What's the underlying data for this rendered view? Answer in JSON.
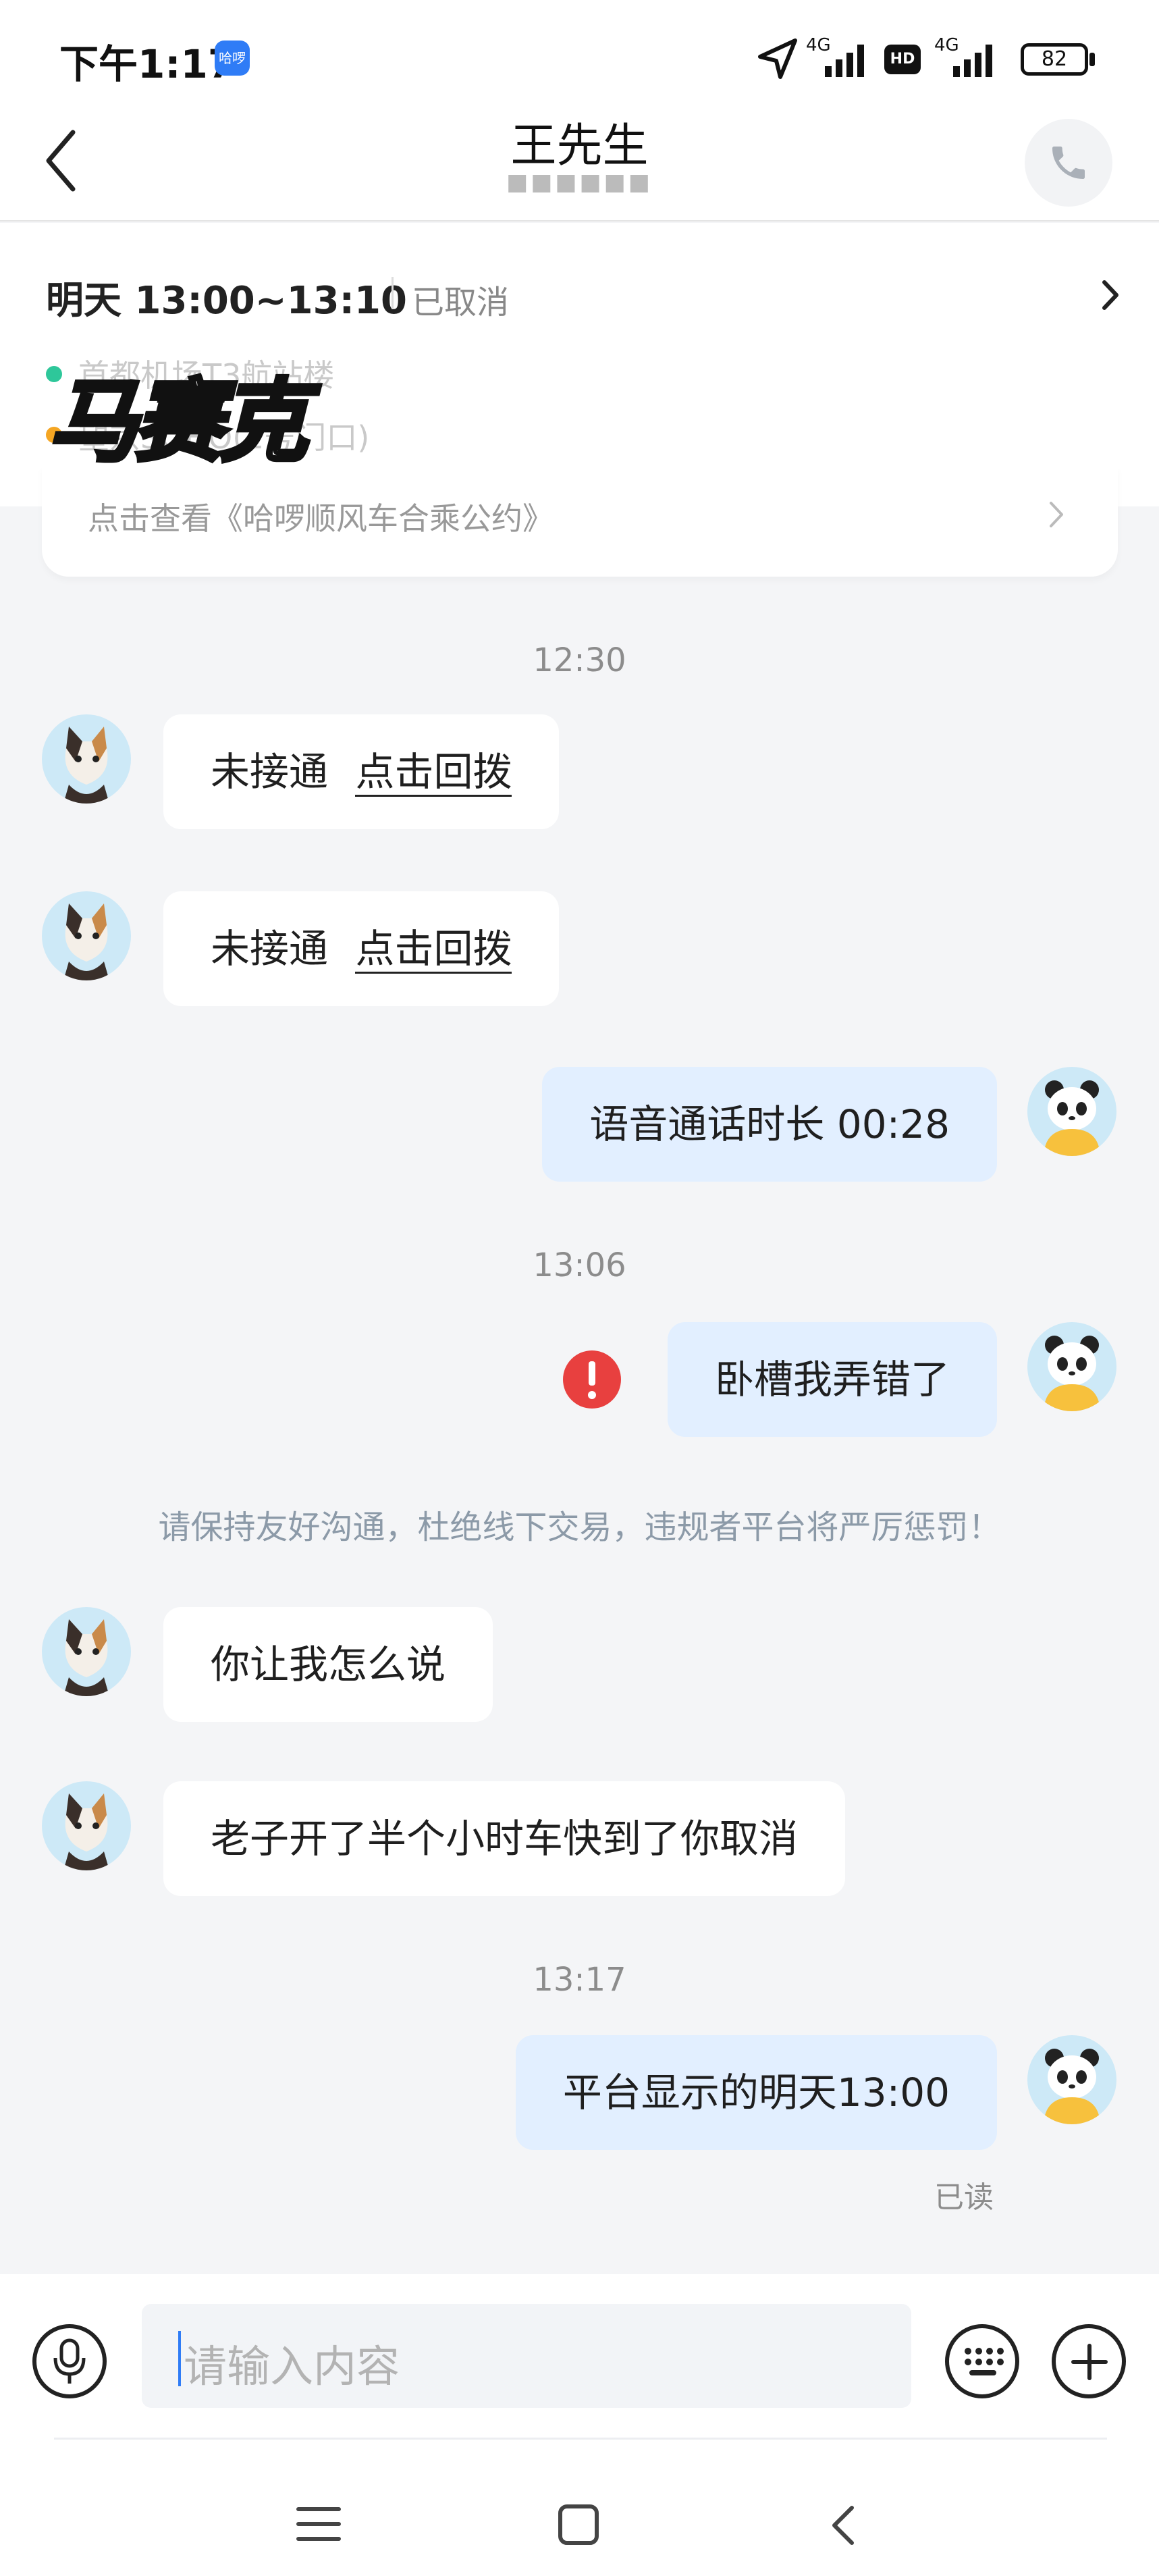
{
  "status_bar": {
    "time": "下午1:17",
    "app_badge": "哈啰",
    "net1": "4G",
    "hd": "HD",
    "net2": "4G",
    "battery": "82"
  },
  "header": {
    "title": "王先生",
    "subtitle": "■■■■■■"
  },
  "trip": {
    "time": "明天 13:00~13:10",
    "status": "已取消",
    "pickup_label": "首都机场T3航站楼",
    "dropoff_label": "望京SOHO(2号门口)",
    "watermark": "马赛克",
    "agreement_link": "点击查看《哈啰顺风车合乘公约》"
  },
  "messages": {
    "ts1": "12:30",
    "m1_text": "未接通",
    "m1_link": "点击回拨",
    "m2_text": "未接通",
    "m2_link": "点击回拨",
    "m3": "语音通话时长 00:28",
    "ts2": "13:06",
    "m4": "卧槽我弄错了",
    "notice": "请保持友好沟通，杜绝线下交易，违规者平台将严厉惩罚！",
    "m5": "你让我怎么说",
    "m6": "老子开了半个小时车快到了你取消",
    "ts3": "13:17",
    "m7": "平台显示的明天13:00",
    "read_status": "已读"
  },
  "input": {
    "placeholder": "请输入内容"
  },
  "colors": {
    "accent": "#2f7cf6",
    "out_bubble": "#e2efff",
    "error": "#e8403f",
    "bg": "#f4f5f7"
  },
  "icons": [
    "back-arrow-icon",
    "phone-icon",
    "chevron-right-icon",
    "error-icon",
    "microphone-icon",
    "keyboard-icon",
    "plus-icon",
    "menu-icon",
    "home-icon",
    "back-icon"
  ]
}
